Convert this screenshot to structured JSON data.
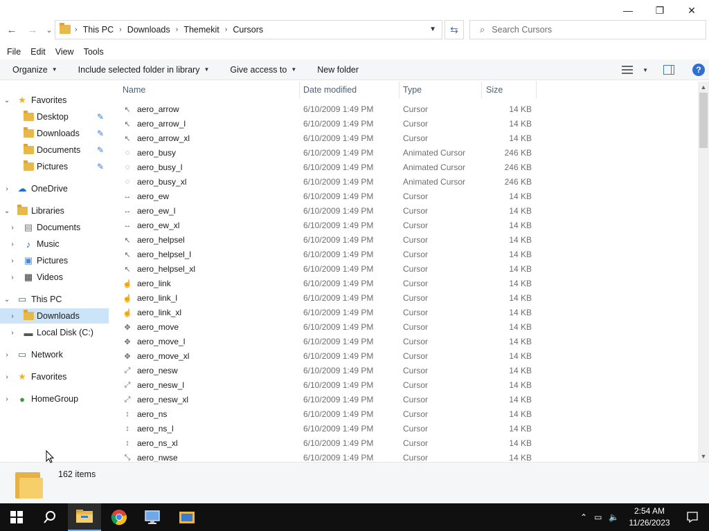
{
  "window": {
    "controls": {
      "minimize": "—",
      "maximize": "❐",
      "close": "✕"
    }
  },
  "nav": {
    "back": "←",
    "forward": "→",
    "recent": "⌄",
    "up": "↑"
  },
  "address": {
    "crumbs": [
      "This PC",
      "Downloads",
      "Themekit",
      "Cursors"
    ]
  },
  "search": {
    "placeholder": "Search Cursors"
  },
  "menu": {
    "items": [
      "File",
      "Edit",
      "View",
      "Tools"
    ]
  },
  "toolbar": {
    "organize": "Organize",
    "include": "Include selected folder in library",
    "give_access": "Give access to",
    "new_folder": "New folder"
  },
  "navpane": {
    "favorites": "Favorites",
    "desktop": "Desktop",
    "downloads": "Downloads",
    "documents": "Documents",
    "pictures": "Pictures",
    "onedrive": "OneDrive",
    "libraries": "Libraries",
    "lib_documents": "Documents",
    "lib_music": "Music",
    "lib_pictures": "Pictures",
    "lib_videos": "Videos",
    "thispc": "This PC",
    "pc_downloads": "Downloads",
    "local_disk": "Local Disk (C:)",
    "network": "Network",
    "favorites2": "Favorites",
    "homegroup": "HomeGroup"
  },
  "columns": {
    "name": "Name",
    "date": "Date modified",
    "type": "Type",
    "size": "Size"
  },
  "files": [
    {
      "name": "aero_arrow",
      "date": "6/10/2009 1:49 PM",
      "type": "Cursor",
      "size": "14 KB",
      "icon": "↖"
    },
    {
      "name": "aero_arrow_l",
      "date": "6/10/2009 1:49 PM",
      "type": "Cursor",
      "size": "14 KB",
      "icon": "↖"
    },
    {
      "name": "aero_arrow_xl",
      "date": "6/10/2009 1:49 PM",
      "type": "Cursor",
      "size": "14 KB",
      "icon": "↖"
    },
    {
      "name": "aero_busy",
      "date": "6/10/2009 1:49 PM",
      "type": "Animated Cursor",
      "size": "246 KB",
      "icon": "◌"
    },
    {
      "name": "aero_busy_l",
      "date": "6/10/2009 1:49 PM",
      "type": "Animated Cursor",
      "size": "246 KB",
      "icon": "◌"
    },
    {
      "name": "aero_busy_xl",
      "date": "6/10/2009 1:49 PM",
      "type": "Animated Cursor",
      "size": "246 KB",
      "icon": "◌"
    },
    {
      "name": "aero_ew",
      "date": "6/10/2009 1:49 PM",
      "type": "Cursor",
      "size": "14 KB",
      "icon": "↔"
    },
    {
      "name": "aero_ew_l",
      "date": "6/10/2009 1:49 PM",
      "type": "Cursor",
      "size": "14 KB",
      "icon": "↔"
    },
    {
      "name": "aero_ew_xl",
      "date": "6/10/2009 1:49 PM",
      "type": "Cursor",
      "size": "14 KB",
      "icon": "↔"
    },
    {
      "name": "aero_helpsel",
      "date": "6/10/2009 1:49 PM",
      "type": "Cursor",
      "size": "14 KB",
      "icon": "↖"
    },
    {
      "name": "aero_helpsel_l",
      "date": "6/10/2009 1:49 PM",
      "type": "Cursor",
      "size": "14 KB",
      "icon": "↖"
    },
    {
      "name": "aero_helpsel_xl",
      "date": "6/10/2009 1:49 PM",
      "type": "Cursor",
      "size": "14 KB",
      "icon": "↖"
    },
    {
      "name": "aero_link",
      "date": "6/10/2009 1:49 PM",
      "type": "Cursor",
      "size": "14 KB",
      "icon": "☝"
    },
    {
      "name": "aero_link_l",
      "date": "6/10/2009 1:49 PM",
      "type": "Cursor",
      "size": "14 KB",
      "icon": "☝"
    },
    {
      "name": "aero_link_xl",
      "date": "6/10/2009 1:49 PM",
      "type": "Cursor",
      "size": "14 KB",
      "icon": "☝"
    },
    {
      "name": "aero_move",
      "date": "6/10/2009 1:49 PM",
      "type": "Cursor",
      "size": "14 KB",
      "icon": "✥"
    },
    {
      "name": "aero_move_l",
      "date": "6/10/2009 1:49 PM",
      "type": "Cursor",
      "size": "14 KB",
      "icon": "✥"
    },
    {
      "name": "aero_move_xl",
      "date": "6/10/2009 1:49 PM",
      "type": "Cursor",
      "size": "14 KB",
      "icon": "✥"
    },
    {
      "name": "aero_nesw",
      "date": "6/10/2009 1:49 PM",
      "type": "Cursor",
      "size": "14 KB",
      "icon": "⤢"
    },
    {
      "name": "aero_nesw_l",
      "date": "6/10/2009 1:49 PM",
      "type": "Cursor",
      "size": "14 KB",
      "icon": "⤢"
    },
    {
      "name": "aero_nesw_xl",
      "date": "6/10/2009 1:49 PM",
      "type": "Cursor",
      "size": "14 KB",
      "icon": "⤢"
    },
    {
      "name": "aero_ns",
      "date": "6/10/2009 1:49 PM",
      "type": "Cursor",
      "size": "14 KB",
      "icon": "↕"
    },
    {
      "name": "aero_ns_l",
      "date": "6/10/2009 1:49 PM",
      "type": "Cursor",
      "size": "14 KB",
      "icon": "↕"
    },
    {
      "name": "aero_ns_xl",
      "date": "6/10/2009 1:49 PM",
      "type": "Cursor",
      "size": "14 KB",
      "icon": "↕"
    },
    {
      "name": "aero_nwse",
      "date": "6/10/2009 1:49 PM",
      "type": "Cursor",
      "size": "14 KB",
      "icon": "⤡"
    }
  ],
  "status": {
    "count": "162 items"
  },
  "taskbar": {
    "time": "2:54 AM",
    "date": "11/26/2023"
  },
  "colors": {
    "accent": "#3a7bd5",
    "selection": "#cce4f7",
    "folder": "#e8b84a",
    "taskbar": "#101010"
  }
}
